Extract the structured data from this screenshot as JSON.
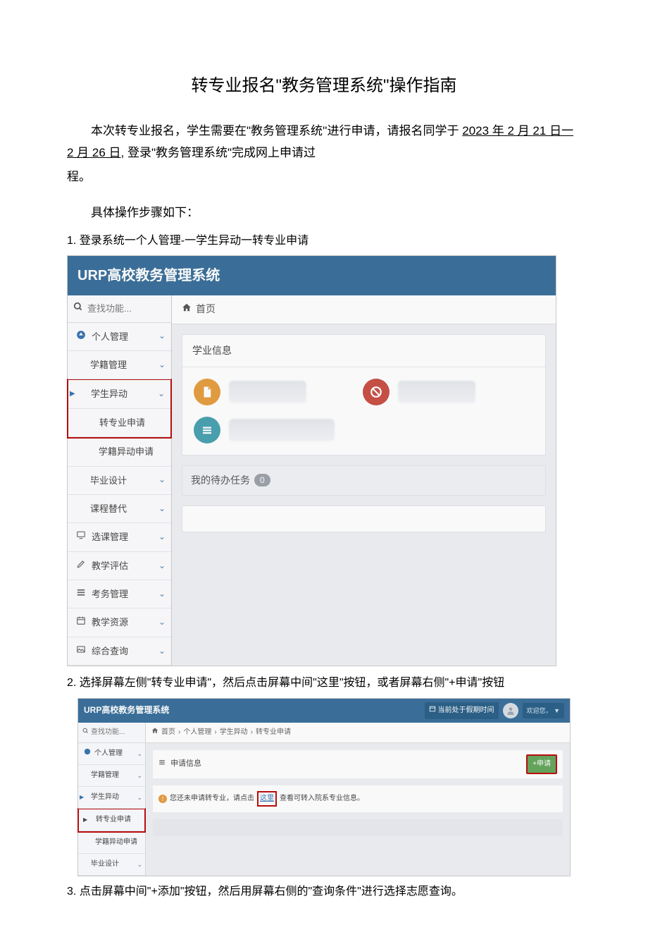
{
  "title": "转专业报名\"教务管理系统\"操作指南",
  "intro": {
    "p1a": "本次转专业报名，学生需要在\"教务管理系统''进行申请，请报名同学于",
    "date": "2023 年 2 月 21 日一 2 月 26 日",
    "p1b": ", 登录\"教务管理系统\"完成网上申请过",
    "p2": "程。",
    "p3": "具体操作步骤如下："
  },
  "step1": "1. 登录系统一个人管理-一学生异动一转专业申请",
  "step2": "2. 选择屏幕左侧\"转专业申请\"，然后点击屏幕中间\"这里\"按钮，或者屏幕右侧\"+申请\"按钮",
  "step3": "3. 点击屏幕中间\"+添加\"按钮，然后用屏幕右侧的\"查询条件\"进行选择志愿查询。",
  "shot1": {
    "system_title": "URP高校教务管理系统",
    "search_placeholder": "查找功能...",
    "sidebar": {
      "personal": "个人管理",
      "status": "学籍管理",
      "change": "学生异动",
      "change_major": "转专业申请",
      "status_change": "学籍异动申请",
      "grad": "毕业设计",
      "course_sub": "课程替代",
      "course_select": "选课管理",
      "teach_eval": "教学评估",
      "exam": "考务管理",
      "resource": "教学资源",
      "query": "综合查询"
    },
    "home": "首页",
    "card_title": "学业信息",
    "task_title": "我的待办任务",
    "task_count": "0"
  },
  "shot2": {
    "system_title": "URP高校教务管理系统",
    "vacation": "当前处于假期时间",
    "welcome": "欢迎您，",
    "welcome_tri": "▼",
    "search_placeholder": "查找功能...",
    "sidebar": {
      "personal": "个人管理",
      "status": "学籍管理",
      "change": "学生异动",
      "change_major": "转专业申请",
      "status_change": "学籍异动申请",
      "grad": "毕业设计"
    },
    "crumb": {
      "home": "首页",
      "arrow": "›",
      "c1": "个人管理",
      "c2": "学生异动",
      "c3": "转专业申请"
    },
    "panel_title": "申请信息",
    "add_btn": "+申请",
    "msg_a": "您还未申请转专业，请点击",
    "msg_link": "这里",
    "msg_b": "查看可转入院系专业信息。"
  }
}
